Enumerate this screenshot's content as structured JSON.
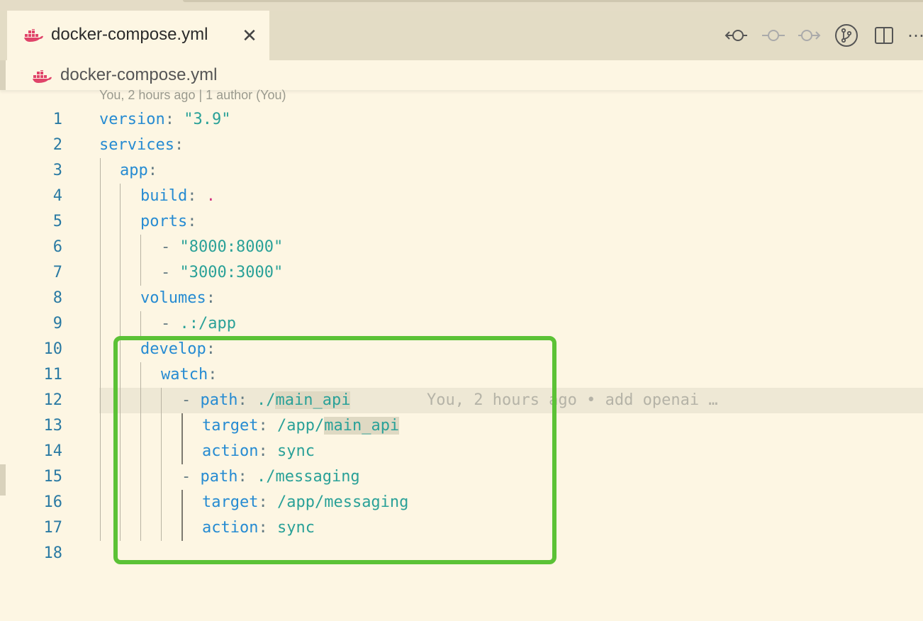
{
  "tab": {
    "label": "docker-compose.yml",
    "close": "✕"
  },
  "toolbar": {
    "more": "⋯"
  },
  "breadcrumb": {
    "label": "docker-compose.yml"
  },
  "blame_header": "You, 2 hours ago | 1 author (You)",
  "inline_blame": "You, 2 hours ago • add openai …",
  "line_numbers": [
    "1",
    "2",
    "3",
    "4",
    "5",
    "6",
    "7",
    "8",
    "9",
    "10",
    "11",
    "12",
    "13",
    "14",
    "15",
    "16",
    "17",
    "18"
  ],
  "code": {
    "l1": {
      "key": "version",
      "colon": ": ",
      "value": "\"3.9\""
    },
    "l2": {
      "key": "services",
      "colon": ":"
    },
    "l3": {
      "key": "app",
      "colon": ":"
    },
    "l4": {
      "key": "build",
      "colon": ": ",
      "value": "."
    },
    "l5": {
      "key": "ports",
      "colon": ":"
    },
    "l6": {
      "dash": "- ",
      "value": "\"8000:8000\""
    },
    "l7": {
      "dash": "- ",
      "value": "\"3000:3000\""
    },
    "l8": {
      "key": "volumes",
      "colon": ":"
    },
    "l9": {
      "dash": "- ",
      "value": ".:/app"
    },
    "l10": {
      "key": "develop",
      "colon": ":"
    },
    "l11": {
      "key": "watch",
      "colon": ":"
    },
    "l12": {
      "dash": "- ",
      "key": "path",
      "colon": ": ",
      "value_pre": "./",
      "value_hl": "main_api"
    },
    "l13": {
      "key": "target",
      "colon": ": ",
      "value_pre": "/app/",
      "value_hl": "main_api"
    },
    "l14": {
      "key": "action",
      "colon": ": ",
      "value": "sync"
    },
    "l15": {
      "dash": "- ",
      "key": "path",
      "colon": ": ",
      "value": "./messaging"
    },
    "l16": {
      "key": "target",
      "colon": ": ",
      "value": "/app/messaging"
    },
    "l17": {
      "key": "action",
      "colon": ": ",
      "value": "sync"
    }
  },
  "colors": {
    "highlight_box": "#5bc236",
    "background": "#fdf6e3",
    "key": "#268bd2",
    "string": "#2aa198"
  }
}
